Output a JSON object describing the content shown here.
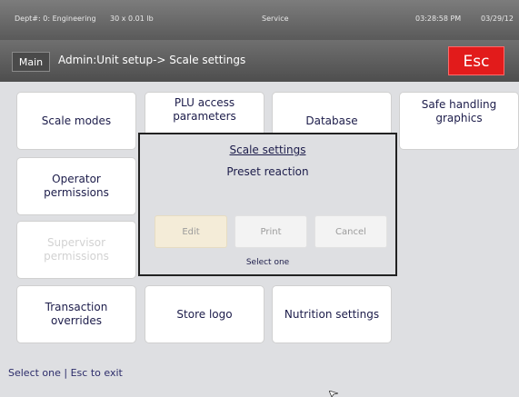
{
  "status_bar": {
    "dept": "Dept#: 0: Engineering",
    "weight": "30 x 0.01 lb",
    "mode": "Service",
    "time": "03:28:58 PM",
    "date": "03/29/12"
  },
  "title_bar": {
    "main_label": "Main",
    "breadcrumb": "Admin:Unit setup-> Scale settings",
    "esc_label": "Esc"
  },
  "tiles": {
    "scale_modes": "Scale modes",
    "plu_access": "PLU access parameters",
    "database": "Database",
    "safe_handling": "Safe handling graphics",
    "operator_permissions": "Operator permissions",
    "supervisor_permissions": "Supervisor permissions",
    "transaction_overrides": "Transaction overrides",
    "store_logo": "Store logo",
    "nutrition_settings": "Nutrition settings"
  },
  "dialog": {
    "title": "Scale settings",
    "subtitle": "Preset reaction",
    "edit_label": "Edit",
    "print_label": "Print",
    "cancel_label": "Cancel",
    "footer": "Select one"
  },
  "footer": {
    "hint": "Select one | Esc to exit"
  },
  "colors": {
    "esc_button": "#e21b1b",
    "panel_background": "#dedfe2",
    "edit_button": "#f4ecd8"
  }
}
